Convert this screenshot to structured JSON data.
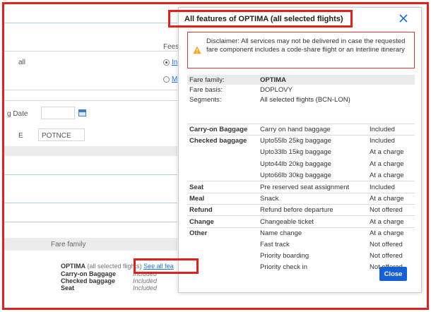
{
  "background": {
    "fees_label": "Fees",
    "radio1_label": "In",
    "radio2_label": "M",
    "all_label": "all",
    "date_label": "g Date",
    "code_left": "E",
    "code_value": "POTNCE",
    "fare_family_header": "Fare family",
    "summary": {
      "fare_name": "OPTIMA",
      "fare_scope": "(all selected flights)",
      "see_all_link": "See all fea",
      "rows": [
        {
          "label": "Carry-on Baggage",
          "value": "Included"
        },
        {
          "label": "Checked baggage",
          "value": "Included"
        },
        {
          "label": "Seat",
          "value": "Included"
        }
      ]
    }
  },
  "modal": {
    "title": "All features of OPTIMA (all selected flights)",
    "disclaimer": "Disclaimer: All services may not be delivered in case the requested fare component includes a code-share flight or an interline itinerary",
    "info": [
      {
        "label": "Fare family:",
        "value": "OPTIMA"
      },
      {
        "label": "Fare basis:",
        "value": "DOPLOVY"
      },
      {
        "label": "Segments:",
        "value": "All selected flights (BCN-LON)"
      }
    ],
    "features": [
      {
        "category": "Carry-on Baggage",
        "description": "Carry on hand baggage",
        "status": "Included"
      },
      {
        "category": "Checked baggage",
        "description": "Upto55lb 25kg baggage",
        "status": "Included"
      },
      {
        "category": "",
        "description": "Upto33lb 15kg baggage",
        "status": "At a charge"
      },
      {
        "category": "",
        "description": "Upto44lb 20kg baggage",
        "status": "At a charge"
      },
      {
        "category": "",
        "description": "Upto66lb 30kg baggage",
        "status": "At a charge"
      },
      {
        "category": "Seat",
        "description": "Pre reserved seat assignment",
        "status": "Included"
      },
      {
        "category": "Meal",
        "description": "Snack",
        "status": "At a charge"
      },
      {
        "category": "Refund",
        "description": "Refund before departure",
        "status": "Not offered"
      },
      {
        "category": "Change",
        "description": "Changeable ticket",
        "status": "At a charge"
      },
      {
        "category": "Other",
        "description": "Name change",
        "status": "At a charge"
      },
      {
        "category": "",
        "description": "Fast track",
        "status": "Not offered"
      },
      {
        "category": "",
        "description": "Priority boarding",
        "status": "Not offered"
      },
      {
        "category": "",
        "description": "Priority check in",
        "status": "Not offered"
      }
    ],
    "close_label": "Close"
  },
  "colors": {
    "accent": "#1560d8",
    "highlight": "#e3201b",
    "warning": "#f5a623"
  }
}
